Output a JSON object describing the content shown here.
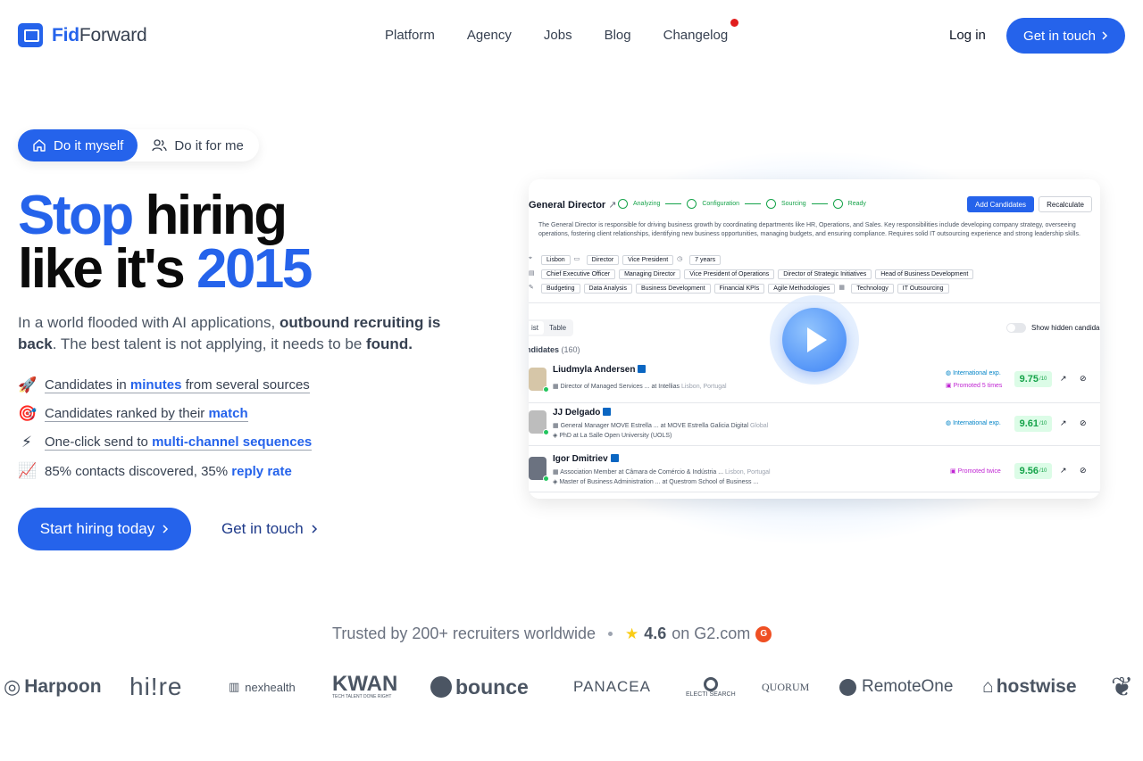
{
  "nav": {
    "brand_bold": "Fid",
    "brand_rest": "Forward",
    "menu": [
      "Platform",
      "Agency",
      "Jobs",
      "Blog",
      "Changelog"
    ],
    "login": "Log in",
    "cta": "Get in touch"
  },
  "toggle": {
    "active": "Do it myself",
    "inactive": "Do it for me"
  },
  "hero": {
    "h1_a": "Stop",
    "h1_b": " hiring",
    "h2_a": "like it's ",
    "h2_b": "2015",
    "sub_1": "In a world flooded with AI applications, ",
    "sub_2": "outbound recruiting is back",
    "sub_3": ". The best talent is not applying, it needs to be ",
    "sub_4": "found.",
    "features": [
      {
        "icon": "🚀",
        "pre": "Candidates in ",
        "hl": "minutes",
        "post": " from several sources"
      },
      {
        "icon": "🎯",
        "pre": "Candidates ranked by their ",
        "hl": "match",
        "post": ""
      },
      {
        "icon": "⚡",
        "pre": "One-click send to ",
        "hl": "multi-channel sequences",
        "post": ""
      },
      {
        "icon": "📈",
        "pre": "85% contacts discovered, 35% ",
        "hl": "reply rate",
        "post": ""
      }
    ],
    "cta_primary": "Start hiring today",
    "cta_secondary": "Get in touch"
  },
  "preview": {
    "title": "General Director",
    "steps": [
      "Analyzing",
      "Configuration",
      "Sourcing",
      "Ready"
    ],
    "add_btn": "Add Candidates",
    "recalc_btn": "Recalculate",
    "description": "The General Director is responsible for driving business growth by coordinating departments like HR, Operations, and Sales. Key responsibilities include developing company strategy, overseeing operations, fostering client relationships, identifying new business opportunities, managing budgets, and ensuring compliance. Requires solid IT outsourcing experience and strong leadership skills.",
    "tags_row1": [
      "Lisbon",
      "Director",
      "Vice President",
      "7 years"
    ],
    "tags_row2": [
      "Chief Executive Officer",
      "Managing Director",
      "Vice President of Operations",
      "Director of Strategic Initiatives",
      "Head of Business Development"
    ],
    "tags_row3a": [
      "Budgeting",
      "Data Analysis",
      "Business Development",
      "Financial KPIs",
      "Agile Methodologies"
    ],
    "tags_row3b": [
      "Technology",
      "IT Outsourcing"
    ],
    "view_list": "ist",
    "view_table": "Table",
    "show_hidden": "Show hidden candida",
    "candidates_label": "ndidates",
    "candidates_count": "(160)",
    "rows": [
      {
        "name": "Liudmyla Andersen",
        "line1": "Director of Managed Services ... at Intellias",
        "line1_loc": "Lisbon, Portugal",
        "line2": "",
        "badge_a": "International exp.",
        "badge_b": "Promoted 5 times",
        "score": "9.75"
      },
      {
        "name": "JJ Delgado",
        "line1": "General Manager MOVE Estrella ... at MOVE Estrella Galicia Digital",
        "line1_loc": "Global",
        "line2": "PhD at La Salle Open University (UOLS)",
        "badge_a": "International exp.",
        "badge_b": "",
        "score": "9.61"
      },
      {
        "name": "Igor Dmitriev",
        "line1": "Association Member at Câmara de Comércio & Indústria ...",
        "line1_loc": "Lisbon, Portugal",
        "line2": "Master of Business Administration ... at Questrom School of Business ...",
        "badge_a": "",
        "badge_b": "Promoted twice",
        "score": "9.56"
      }
    ],
    "score_unit": "/10"
  },
  "trust": {
    "text": "Trusted by 200+ recruiters worldwide",
    "rating": "4.6",
    "rating_suffix": "on G2.com",
    "g2_label": "G"
  },
  "logos": [
    "Harpoon",
    "hi!re",
    "nexhealth",
    "KWAN",
    "bounce",
    "PANACEA",
    "ELECTI SEARCH",
    "QUORUM",
    "RemoteOne",
    "hostwise"
  ],
  "logo_sub_kwan": "TECH TALENT DONE RIGHT",
  "colors": {
    "brand": "#2563eb",
    "score_bg": "#dcfce7",
    "score_text": "#16a34a"
  }
}
